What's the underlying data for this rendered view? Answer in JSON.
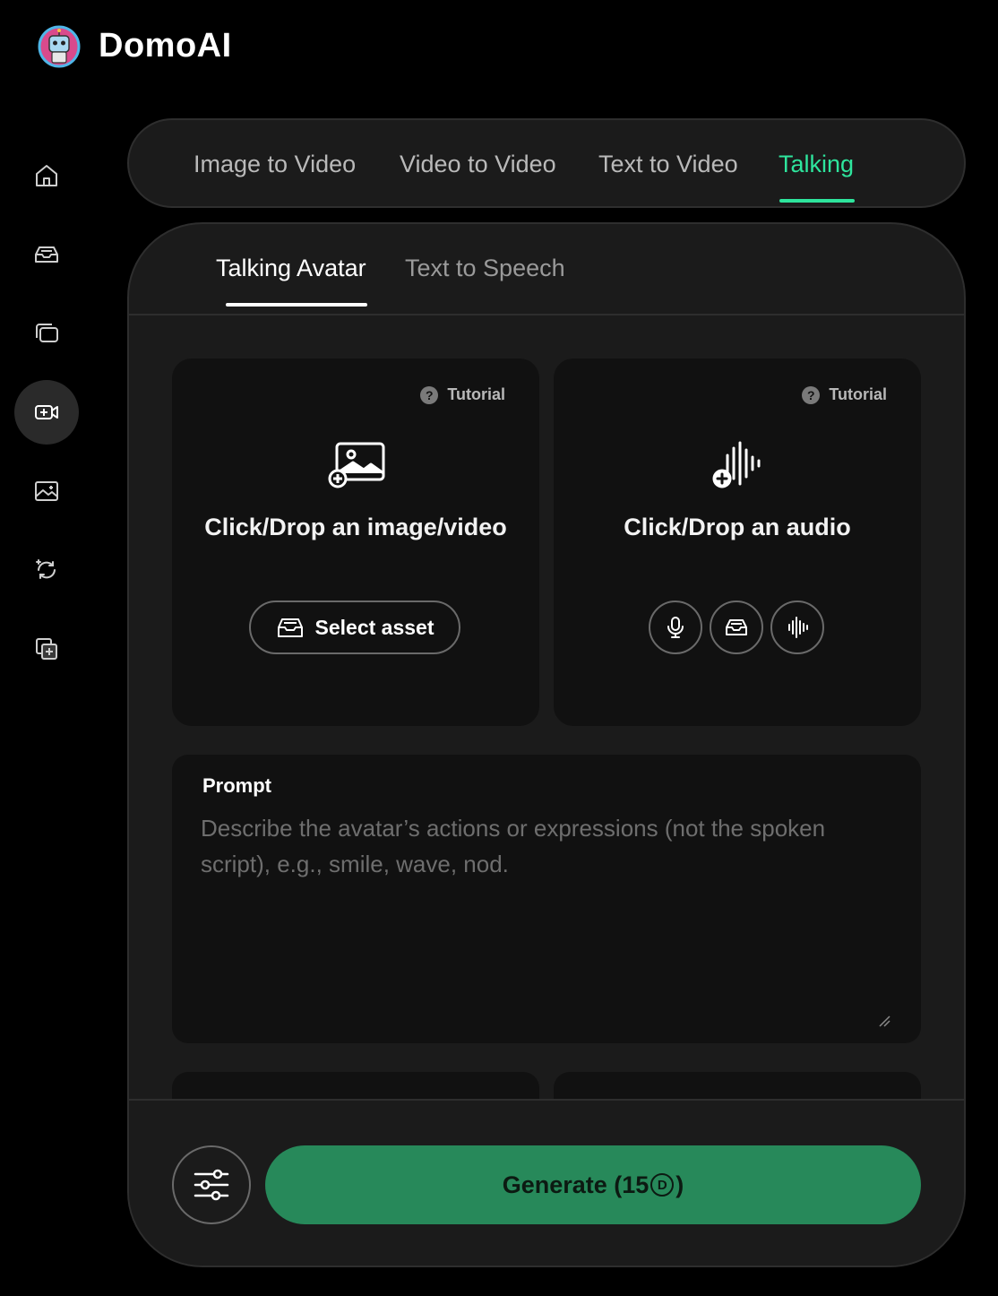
{
  "app": {
    "brand": "DomoAI"
  },
  "sidebar": {
    "items": [
      {
        "icon": "home-icon"
      },
      {
        "icon": "assets-tray-icon"
      },
      {
        "icon": "gallery-icon"
      },
      {
        "icon": "video-create-icon",
        "active": true
      },
      {
        "icon": "image-create-icon"
      },
      {
        "icon": "refresh-sparkle-icon"
      },
      {
        "icon": "add-layers-icon"
      }
    ]
  },
  "mode_tabs": {
    "items": [
      "Image to Video",
      "Video to Video",
      "Text to Video",
      "Talking"
    ],
    "active": "Talking",
    "accent": "#2ee59d"
  },
  "sub_tabs": {
    "items": [
      "Talking Avatar",
      "Text to Speech"
    ],
    "active": "Talking Avatar"
  },
  "image_upload": {
    "tutorial": "Tutorial",
    "text": "Click/Drop an image/video",
    "select_asset": "Select asset"
  },
  "audio_upload": {
    "tutorial": "Tutorial",
    "text": "Click/Drop an audio",
    "buttons": [
      "microphone-icon",
      "assets-tray-icon",
      "waveform-icon"
    ]
  },
  "prompt": {
    "label": "Prompt",
    "placeholder": "Describe the avatar’s actions or expressions (not the spoken script), e.g., smile, wave, nod.",
    "value": ""
  },
  "generate": {
    "label_prefix": "Generate (",
    "cost": "15",
    "label_suffix": ")",
    "color": "#27895a"
  }
}
